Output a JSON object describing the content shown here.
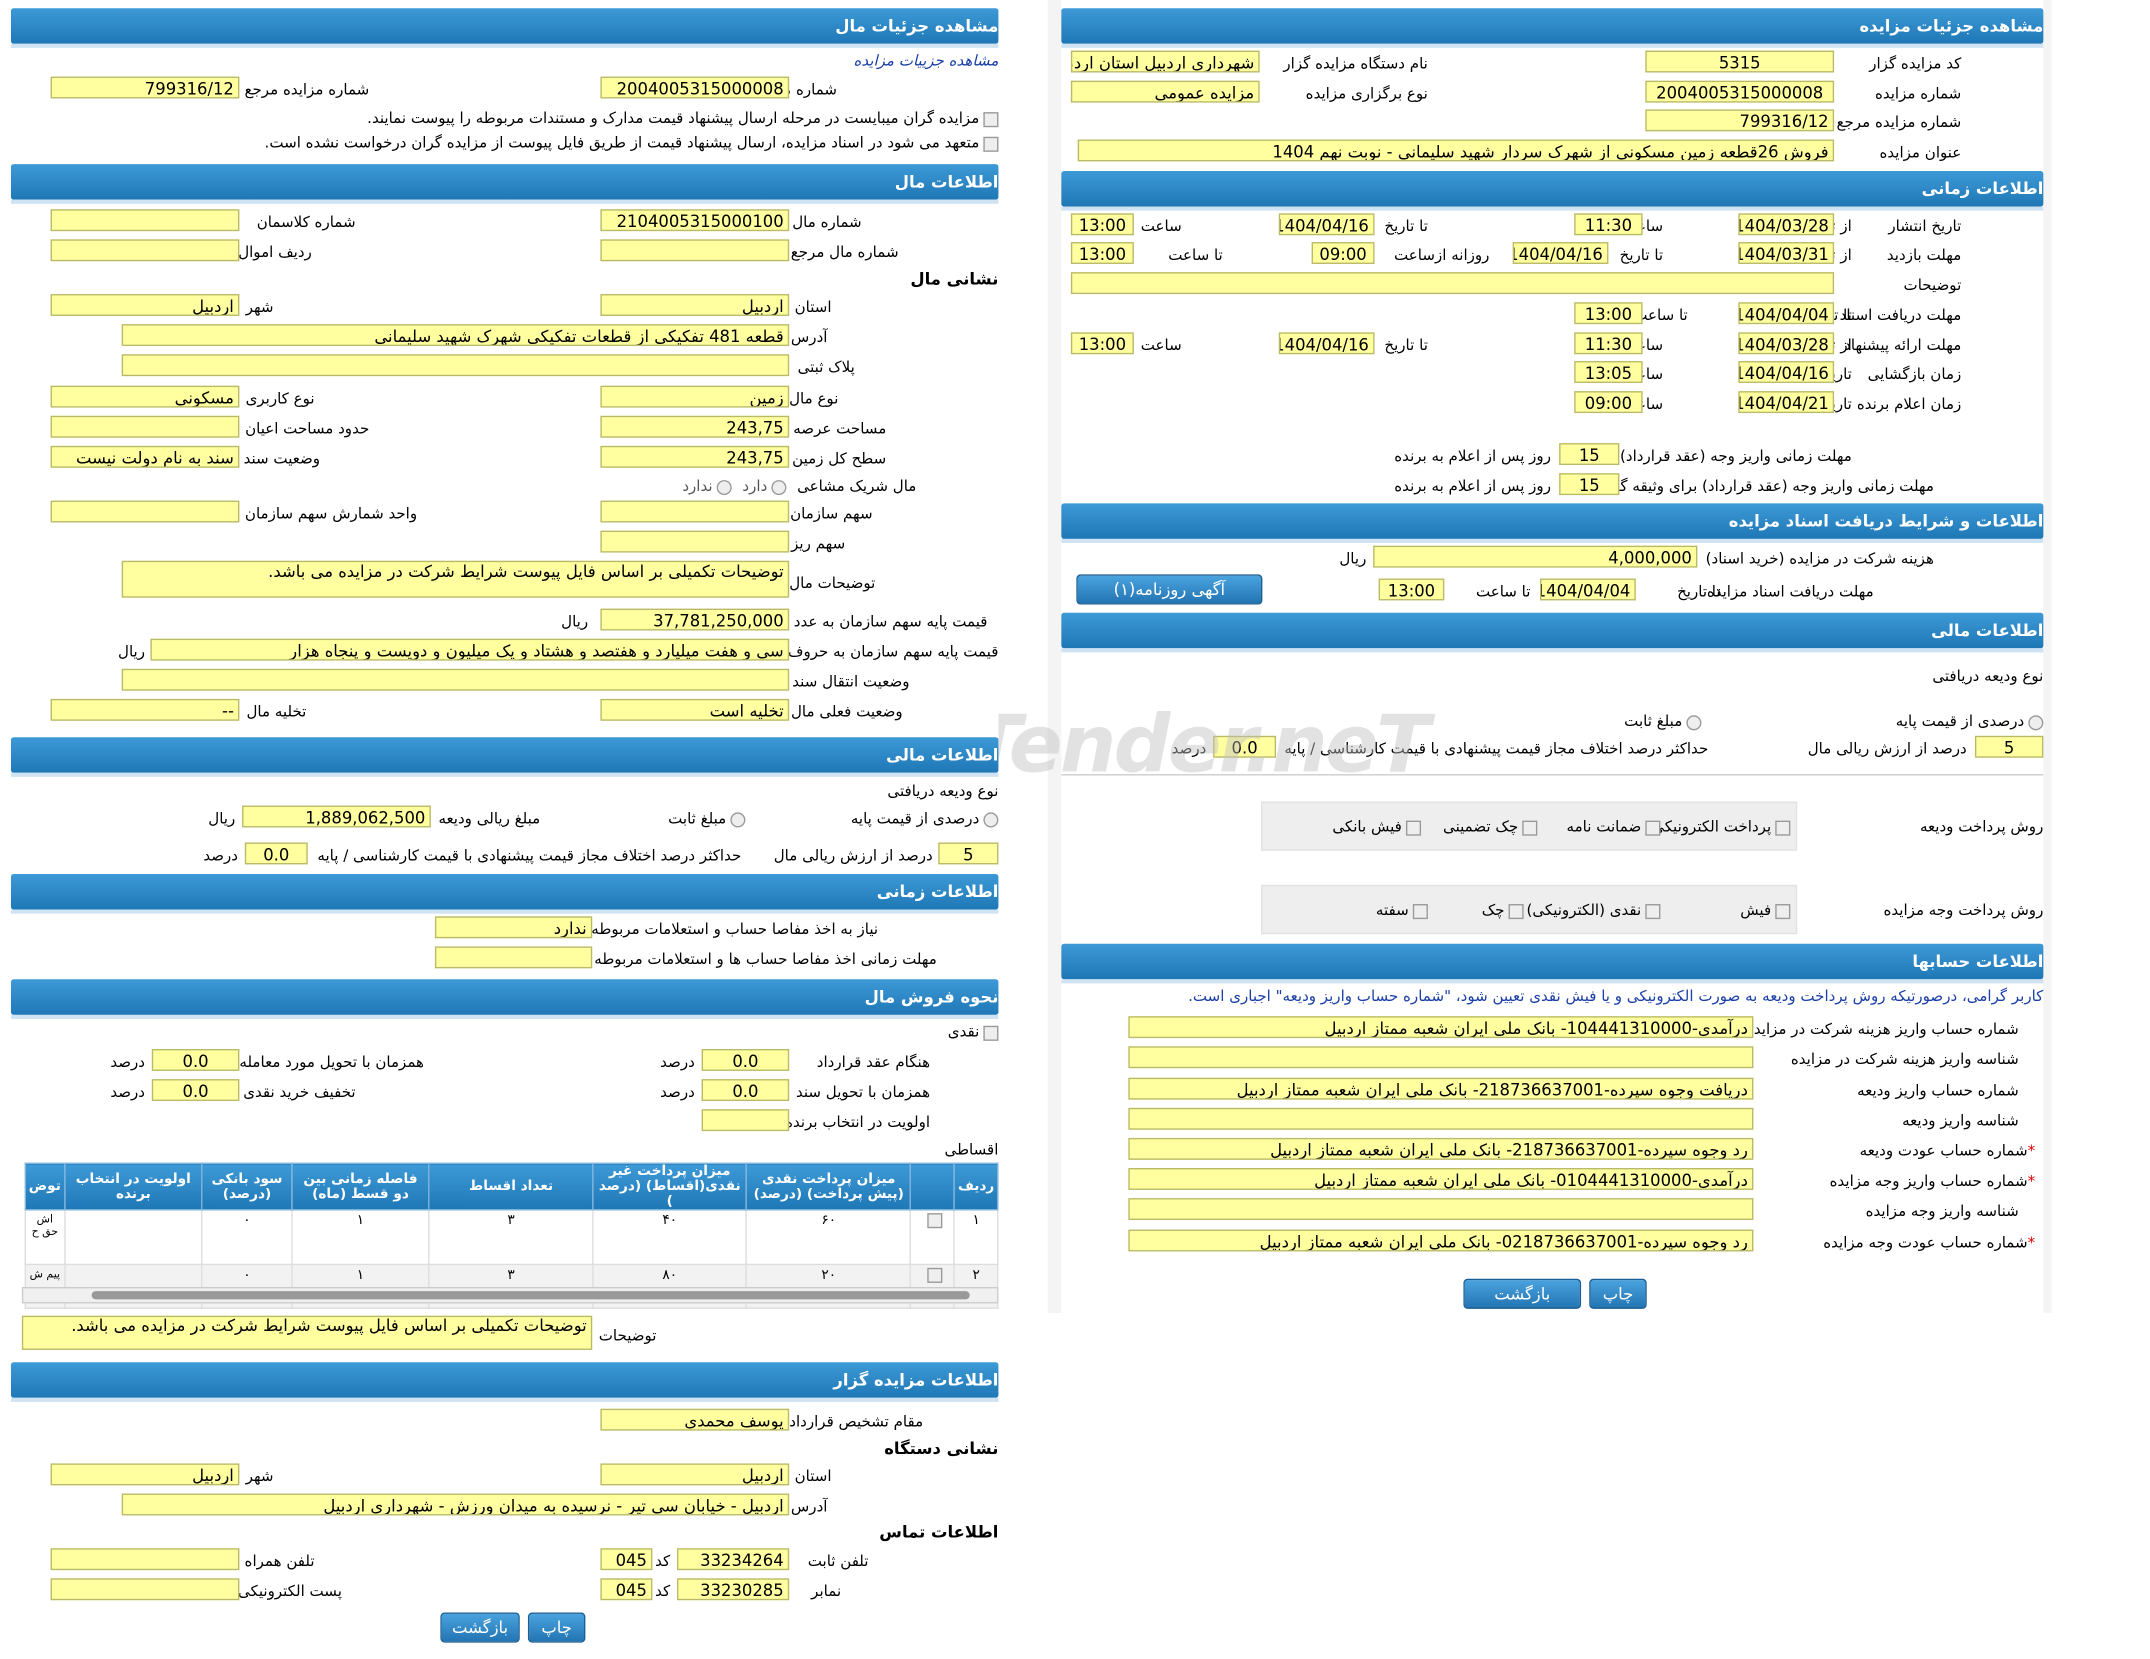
{
  "right": {
    "s1": {
      "title": "مشاهده جزئیات مزایده",
      "code_label": "کد مزایده گزار",
      "code": "5315",
      "org_label": "نام دستگاه مزایده گزار",
      "org": "شهرداری اردبیل استان اردبیل",
      "num_label": "شماره مزایده",
      "num": "2004005315000008",
      "type_label": "نوع برگزاری مزایده",
      "type": "مزایده عمومی",
      "ref_label": "شماره مزایده مرجع",
      "ref": "799316/12",
      "subj_label": "عنوان مزایده",
      "subj": "فروش 26قطعه زمين مسكوني از شهرک سردار شهيد سليماني - نوبت نهم 1404"
    },
    "s2": {
      "title": "اطلاعات زمانی",
      "pub_label": "تاریخ انتشار",
      "from": "از تاریخ",
      "to": "تا تاریخ",
      "time": "ساعت",
      "to_time": "تا ساعت",
      "pub_from": "1404/03/28",
      "pub_from_t": "11:30",
      "pub_to": "1404/04/16",
      "pub_to_t": "13:00",
      "visit_label": "مهلت بازدید",
      "visit_from": "1404/03/31",
      "visit_to": "1404/04/16",
      "daily": "روزانه ازساعت",
      "visit_d1": "09:00",
      "visit_d2": "13:00",
      "desc_label": "توضیحات",
      "desc": "",
      "doc_label": "مهلت دریافت اسناد",
      "doc_to": "1404/04/04",
      "doc_t": "13:00",
      "offer_label": "مهلت ارائه پیشنهاد",
      "offer_from": "1404/03/28",
      "offer_from_t": "11:30",
      "offer_to": "1404/04/16",
      "offer_to_t": "13:00",
      "open_label": "زمان بازگشایی",
      "date": "تاریخ",
      "open_d": "1404/04/16",
      "open_t": "13:05",
      "win_label": "زمان اعلام برنده",
      "win_d": "1404/04/21",
      "win_t": "09:00",
      "pay1_label": "مهلت زمانی واریز وجه (عقد قرارداد)",
      "pay1": "15",
      "days_after": "روز پس از اعلام به برنده",
      "pay2_label": "مهلت زمانی واریز وجه (عقد قرارداد) برای وثیقه گذار",
      "pay2": "15"
    },
    "s3": {
      "title": "اطلاعات و شرایط دریافت اسناد مزایده",
      "fee_label": "هزینه شرکت در مزایده (خرید اسناد)",
      "fee": "4,000,000",
      "rial": "ریال",
      "dl_label": "مهلت دریافت اسناد مزایده",
      "dl_to": "تا تاریخ",
      "dl_d": "1404/04/04",
      "dl_tt": "تا ساعت",
      "dl_t": "13:00",
      "ad_button": "آگهی روزنامه(۱)"
    },
    "s4": {
      "title": "اطلاعات مالی",
      "dep_type": "نوع ودیعه دریافتی",
      "pct_base": "درصدی از قیمت پایه",
      "fixed": "مبلغ ثابت",
      "pct_val_label": "درصد از ارزش ریالی مال",
      "pct_val": "5",
      "max_diff": "حداکثر درصد اختلاف مجاز قیمت پیشنهادی با قیمت کارشناسی / پایه",
      "max_val": "0.0",
      "pct": "درصد",
      "dep_pay": "روش پرداخت ودیعه",
      "electronic": "پرداخت الکترونیکی",
      "guarantee": "ضمانت نامه",
      "cheque_g": "چک تضمینی",
      "bank_slip": "فیش بانکی",
      "pay_method": "روش پرداخت وجه مزایده",
      "slip": "فیش",
      "cash_e": "نقدی (الکترونیکی)",
      "cheque": "چک",
      "promissory": "سفته"
    },
    "s5": {
      "title": "اطلاعات حسابها",
      "note": "کاربر گرامی، درصورتیکه روش پرداخت ودیعه به صورت الکترونیکی و یا فیش نقدی تعیین شود، \"شماره حساب واریز ودیعه\" اجباری است.",
      "a1_label": "شماره حساب واریز هزینه شرکت در مزایده",
      "a1": "درآمدی-104441310000- بانک ملی ایران شعبه ممتاز اردبیل",
      "a2_label": "شناسه واریز هزینه شرکت در مزایده",
      "a2": "",
      "a3_label": "شماره حساب واریز ودیعه",
      "a3": "دریافت وجوه سپرده-218736637001- بانک ملی ایران شعبه ممتاز اردبیل",
      "a4_label": "شناسه واریز ودیعه",
      "a4": "",
      "a5_label": "شماره حساب عودت ودیعه",
      "a5": "رد وجوه سپرده-218736637001- بانک ملی ایران شعبه ممتاز اردبیل",
      "a6_label": "شماره حساب واریز وجه مزایده",
      "a6": "درآمدی-0104441310000- بانک ملی ایران شعبه ممتاز اردبیل",
      "a7_label": "شناسه واریز وجه مزایده",
      "a7": "",
      "a8_label": "شماره حساب عودت وجه مزایده",
      "a8": "رد وجوه سپرده-0218736637001- بانک ملی ایران شعبه ممتاز اردبیل",
      "star": "*"
    },
    "back": "بازگشت",
    "print": "چاپ"
  },
  "left": {
    "s1": {
      "title": "مشاهده جزئیات مال",
      "link": "مشاهده جزییات مزایده",
      "num_label": "شماره مزایده",
      "num": "2004005315000008",
      "ref_label": "شماره مزایده مرجع",
      "ref": "799316/12",
      "c1": "مزایده گران میبایست در مرحله ارسال پیشنهاد قیمت مدارک و مستندات مربوطه را پیوست نمایند.",
      "c2": "متعهد می شود در اسناد مزایده، ارسال پیشنهاد قیمت از طریق فایل پیوست از مزایده گران درخواست نشده است."
    },
    "s2": {
      "title": "اطلاعات مال",
      "item_label": "شماره مال",
      "item": "2104005315000100",
      "class_label": "شماره کلاسمان",
      "class": "",
      "iref_label": "شماره مال مرجع",
      "iref": "",
      "row_label": "ردیف اموال",
      "row": "",
      "addr_title": "نشانی مال",
      "prov_label": "استان",
      "prov": "اردبیل",
      "city_label": "شهر",
      "city": "اردبیل",
      "addr_label": "آدرس",
      "addr": "قطعه  481 تفکیکی از قطعات تفکیکی شهرک شهید سلیمانی",
      "plate_label": "پلاک ثبتی",
      "plate": "",
      "kind_label": "نوع مال",
      "kind": "زمین",
      "use_label": "نوع کاربری",
      "use": "مسکونی",
      "area_label": "مساحت عرصه",
      "area": "243,75",
      "bld_label": "حدود مساحت اعیان",
      "bld": "",
      "land_label": "سطح کل زمین",
      "land": "243,75",
      "deed_label": "وضعیت سند",
      "deed": "سند به نام دولت نیست",
      "share_label": "مال شریک مشاعی",
      "has": "دارد",
      "hasnot": "ندارد",
      "org_share_label": "سهم سازمان",
      "org_share": "",
      "unit_label": "واحد شمارش سهم سازمان",
      "unit": "",
      "minor_label": "سهم ریز",
      "minor": "",
      "desc_label": "توضیحات مال",
      "desc": "توضیحات تکمیلی بر اساس فایل پیوست شرایط شرکت در مزایده می باشد.",
      "base_label": "قیمت پایه سهم سازمان به عدد",
      "base": "37,781,250,000",
      "rial": "ریال",
      "words_label": "قیمت پایه سهم سازمان به حروف",
      "words": "سی و هفت میلیارد و هفتصد و هشتاد و یک میلیون و دویست و پنجاه هزار",
      "transfer_label": "وضعیت انتقال سند",
      "transfer": "",
      "status_label": "وضعیت فعلی مال",
      "status": "تخلیه است",
      "evac_label": "تخلیه مال",
      "evac": "--"
    },
    "s3": {
      "title": "اطلاعات مالی",
      "dep_type": "نوع ودیعه دریافتی",
      "pct_base": "درصدی از قیمت پایه",
      "fixed": "مبلغ ثابت",
      "amount_label": "مبلغ ریالی ودیعه",
      "amount": "1,889,062,500",
      "rial": "ریال",
      "pct_val": "5",
      "pct_val_label": "درصد از ارزش ریالی مال",
      "max_diff": "حداکثر درصد اختلاف مجاز قیمت پیشنهادی با قیمت کارشناسی / پایه",
      "max_val": "0.0",
      "pct": "درصد"
    },
    "s4": {
      "title": "اطلاعات زمانی",
      "need_label": "نیاز به اخذ مفاصا حساب و استعلامات مربوطه",
      "need": "ندارد",
      "dead_label": "مهلت زمانی اخذ مفاصا حساب ها و استعلامات مربوطه",
      "dead": ""
    },
    "s5": {
      "title": "نحوه فروش مال",
      "cash": "نقدی",
      "contract_label": "هنگام عقد قرارداد",
      "contract": "0.0",
      "deliver_label": "همزمان با تحویل مورد معامله",
      "deliver": "0.0",
      "doc_label": "همزمان با تحویل سند",
      "doc": "0.0",
      "disc_label": "تخفیف خرید نقدی",
      "disc": "0.0",
      "prio_label": "اولویت در انتخاب برنده",
      "prio": "",
      "pct": "درصد",
      "inst": "اقساطی",
      "cols": [
        "ردیف",
        "",
        "میزان پرداخت نقدی (پیش پرداخت) (درصد)",
        "میزان پرداخت غیر نقدی(اقساط) (درصد )",
        "تعداد اقساط",
        "فاصله زمانی بین دو قسط (ماه)",
        "سود بانکی (درصد)",
        "اولویت در انتخاب برنده",
        "توض"
      ],
      "rows": [
        [
          "۱",
          "",
          "۶۰",
          "۴۰",
          "۳",
          "۱",
          "۰",
          "",
          "اش حق ح"
        ],
        [
          "۲",
          "",
          "۲۰",
          "۸۰",
          "۳",
          "۱",
          "۰",
          "",
          "پیم ش"
        ]
      ],
      "desc_label": "توضیحات",
      "desc": "توضیحات تکمیلی بر اساس فایل پیوست شرایط شرکت در مزایده می باشد."
    },
    "s6": {
      "title": "اطلاعات مزایده گزار",
      "auth_label": "مقام تشخیص قرارداد",
      "auth": "یوسف محمدی",
      "org_addr": "نشانی دستگاه",
      "prov_label": "استان",
      "prov": "اردبیل",
      "city_label": "شهر",
      "city": "اردبیل",
      "addr_label": "آدرس",
      "addr": "اردبیل - خیابان سی تیر - نرسیده به میدان ورزش - شهرداری اردبیل",
      "contact": "اطلاعات تماس",
      "tel_label": "تلفن ثابت",
      "tel": "33234264",
      "code_label": "کد",
      "tel_code": "045",
      "mob_label": "تلفن همراه",
      "mob": "",
      "fax_label": "نمابر",
      "fax": "33230285",
      "fax_code": "045",
      "email_label": "پست الکترونیکی",
      "email": ""
    },
    "back": "بازگشت",
    "print": "چاپ"
  }
}
